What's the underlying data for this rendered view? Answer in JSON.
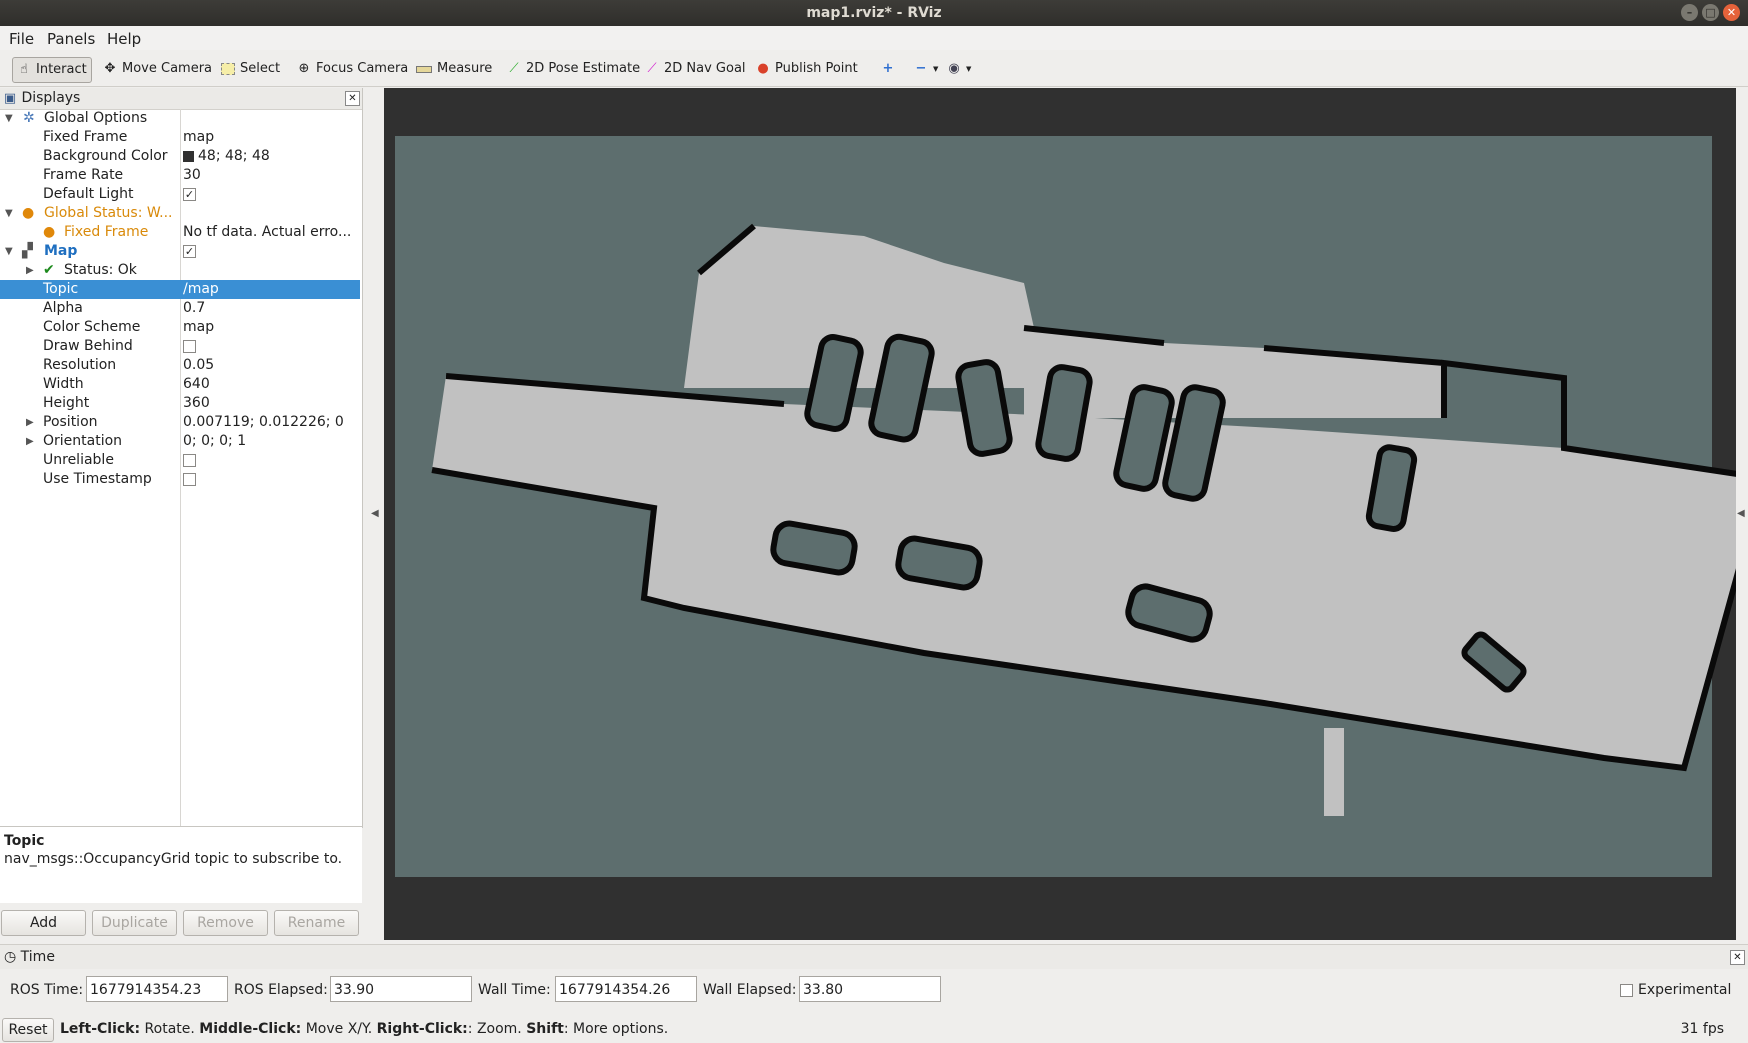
{
  "window": {
    "title": "map1.rviz* - RViz"
  },
  "menubar": [
    "File",
    "Panels",
    "Help"
  ],
  "toolbar": {
    "interact": "Interact",
    "move_camera": "Move Camera",
    "select": "Select",
    "focus_camera": "Focus Camera",
    "measure": "Measure",
    "pose_estimate": "2D Pose Estimate",
    "nav_goal": "2D Nav Goal",
    "publish_point": "Publish Point"
  },
  "displays": {
    "title": "Displays",
    "global_options": "Global Options",
    "fixed_frame_label": "Fixed Frame",
    "fixed_frame_value": "map",
    "bg_color_label": "Background Color",
    "bg_color_value": "48; 48; 48",
    "frame_rate_label": "Frame Rate",
    "frame_rate_value": "30",
    "default_light_label": "Default Light",
    "global_status": "Global Status: W...",
    "status_fixed_frame": "Fixed Frame",
    "status_fixed_frame_value": "No tf data.  Actual erro...",
    "map": "Map",
    "map_status": "Status: Ok",
    "topic_label": "Topic",
    "topic_value": "/map",
    "alpha_label": "Alpha",
    "alpha_value": "0.7",
    "color_scheme_label": "Color Scheme",
    "color_scheme_value": "map",
    "draw_behind_label": "Draw Behind",
    "resolution_label": "Resolution",
    "resolution_value": "0.05",
    "width_label": "Width",
    "width_value": "640",
    "height_label": "Height",
    "height_value": "360",
    "position_label": "Position",
    "position_value": "0.007119; 0.012226; 0",
    "orientation_label": "Orientation",
    "orientation_value": "0; 0; 0; 1",
    "unreliable_label": "Unreliable",
    "use_timestamp_label": "Use Timestamp",
    "check_mark": "✓"
  },
  "description": {
    "title": "Topic",
    "text": "nav_msgs::OccupancyGrid topic to subscribe to."
  },
  "buttons": {
    "add": "Add",
    "duplicate": "Duplicate",
    "remove": "Remove",
    "rename": "Rename"
  },
  "time": {
    "panel_title": "Time",
    "ros_time_label": "ROS Time:",
    "ros_time": "1677914354.23",
    "ros_elapsed_label": "ROS Elapsed:",
    "ros_elapsed": "33.90",
    "wall_time_label": "Wall Time:",
    "wall_time": "1677914354.26",
    "wall_elapsed_label": "Wall Elapsed:",
    "wall_elapsed": "33.80",
    "experimental": "Experimental"
  },
  "status": {
    "reset": "Reset",
    "left_click": "Left-Click:",
    "left_desc": " Rotate. ",
    "middle_click": "Middle-Click:",
    "middle_desc": " Move X/Y. ",
    "right_click": "Right-Click:",
    "right_desc": ": Zoom. ",
    "shift": "Shift",
    "shift_desc": ": More options.",
    "fps": "31 fps"
  },
  "colors": {
    "viewport_bg": "#303030",
    "map_unknown": "#5d6e6e",
    "map_free": "#c1c1c1",
    "map_occupied": "#0a0a0a",
    "selection": "#3a8fd4",
    "warning": "#d98a0a",
    "map_blue": "#1f6fc0"
  }
}
